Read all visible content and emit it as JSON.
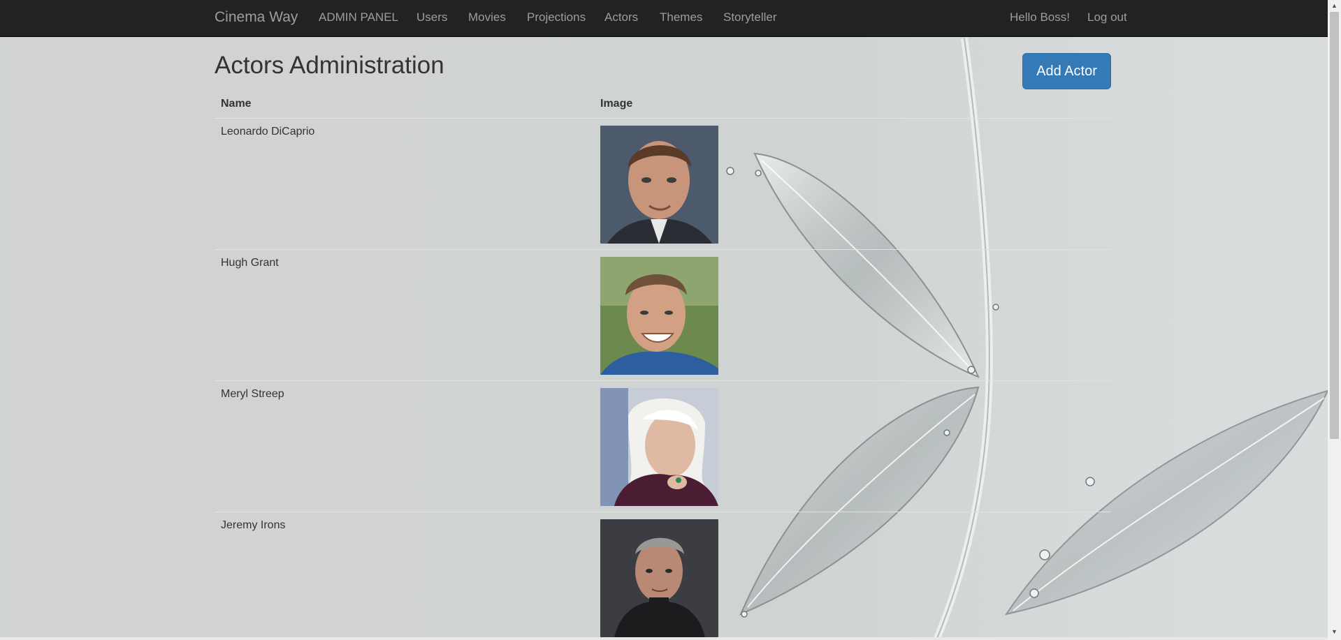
{
  "navbar": {
    "brand": "Cinema Way",
    "links": [
      "ADMIN PANEL",
      "Users",
      "Movies",
      "Projections",
      "Actors",
      "Themes",
      "Storyteller"
    ],
    "greeting": "Hello Boss!",
    "logout": "Log out"
  },
  "page": {
    "title": "Actors Administration",
    "add_button": "Add Actor"
  },
  "table": {
    "headers": [
      "Name",
      "Image"
    ],
    "rows": [
      {
        "name": "Leonardo DiCaprio"
      },
      {
        "name": "Hugh Grant"
      },
      {
        "name": "Meryl Streep"
      },
      {
        "name": "Jeremy Irons"
      }
    ]
  },
  "colors": {
    "navbar_bg": "#222222",
    "nav_text": "#9d9d9d",
    "primary_button": "#337ab7"
  }
}
